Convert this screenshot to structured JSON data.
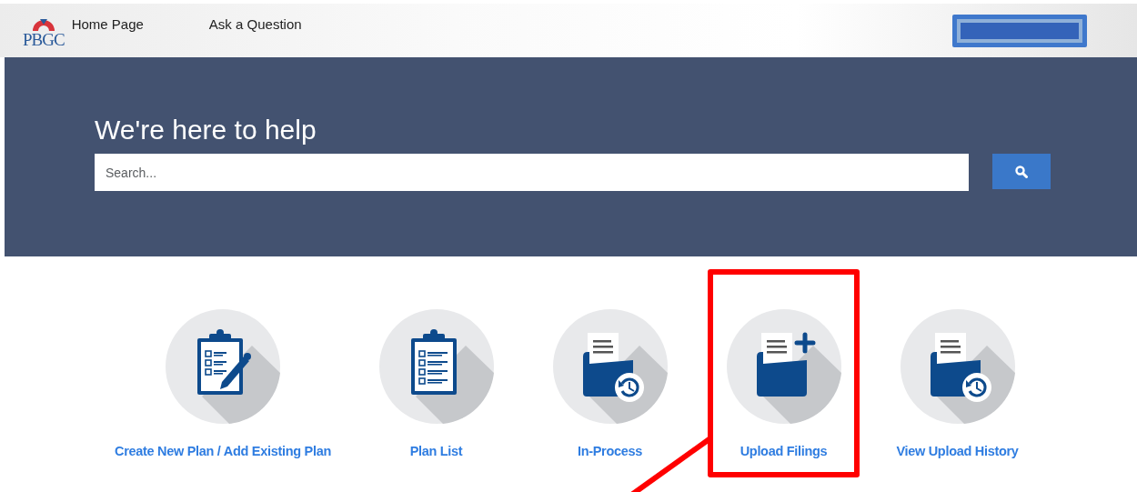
{
  "header": {
    "logo": "PBGC",
    "nav": [
      {
        "label": "Home Page"
      },
      {
        "label": "Ask a Question"
      }
    ]
  },
  "hero": {
    "title": "We're here to help",
    "search": {
      "placeholder": "Search..."
    }
  },
  "tiles": [
    {
      "kind": "checklist-pen",
      "label": "Create New Plan / Add Existing Plan",
      "highlighted": false
    },
    {
      "kind": "checklist",
      "label": "Plan List",
      "highlighted": false
    },
    {
      "kind": "folder-history",
      "label": "In-Process",
      "highlighted": false
    },
    {
      "kind": "folder-plus",
      "label": "Upload Filings",
      "highlighted": true
    },
    {
      "kind": "folder-history",
      "label": "View Upload History",
      "highlighted": false
    }
  ]
}
